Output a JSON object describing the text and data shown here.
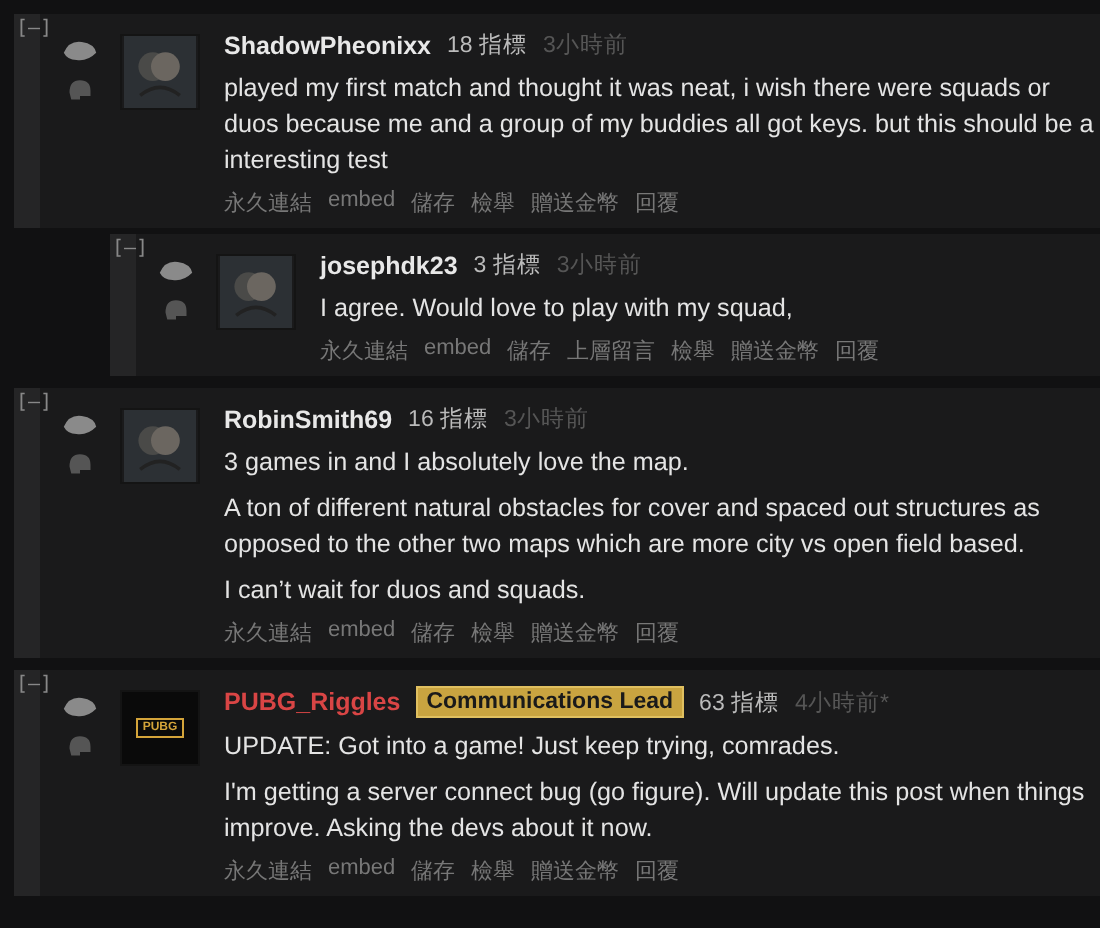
{
  "comments": [
    {
      "collapse": "[–]",
      "author": "ShadowPheonixx",
      "official": false,
      "points": "18 指標",
      "time": "3小時前",
      "avatar": {
        "kind": "default"
      },
      "paragraphs": [
        "played my first match and thought it was neat, i wish there were squads or duos because me and a group of my buddies all got keys. but this should be a interesting test"
      ],
      "actions": [
        "永久連結",
        "embed",
        "儲存",
        "檢舉",
        "贈送金幣",
        "回覆"
      ],
      "children": [
        {
          "collapse": "[–]",
          "author": "josephdk23",
          "official": false,
          "points": "3 指標",
          "time": "3小時前",
          "avatar": {
            "kind": "default"
          },
          "paragraphs": [
            "I agree. Would love to play with my squad,"
          ],
          "actions": [
            "永久連結",
            "embed",
            "儲存",
            "上層留言",
            "檢舉",
            "贈送金幣",
            "回覆"
          ]
        }
      ]
    },
    {
      "collapse": "[–]",
      "author": "RobinSmith69",
      "official": false,
      "points": "16 指標",
      "time": "3小時前",
      "avatar": {
        "kind": "default"
      },
      "paragraphs": [
        "3 games in and I absolutely love the map.",
        "A ton of different natural obstacles for cover and spaced out structures as opposed to the other two maps which are more city vs open field based.",
        "I can’t wait for duos and squads."
      ],
      "actions": [
        "永久連結",
        "embed",
        "儲存",
        "檢舉",
        "贈送金幣",
        "回覆"
      ]
    },
    {
      "collapse": "[–]",
      "author": "PUBG_Riggles",
      "official": true,
      "flair": "Communications Lead",
      "points": "63 指標",
      "time": "4小時前*",
      "avatar": {
        "kind": "logo",
        "text": "PUBG"
      },
      "paragraphs": [
        "UPDATE: Got into a game! Just keep trying, comrades.",
        "I'm getting a server connect bug (go figure). Will update this post when things improve. Asking the devs about it now."
      ],
      "actions": [
        "永久連結",
        "embed",
        "儲存",
        "檢舉",
        "贈送金幣",
        "回覆"
      ]
    }
  ]
}
